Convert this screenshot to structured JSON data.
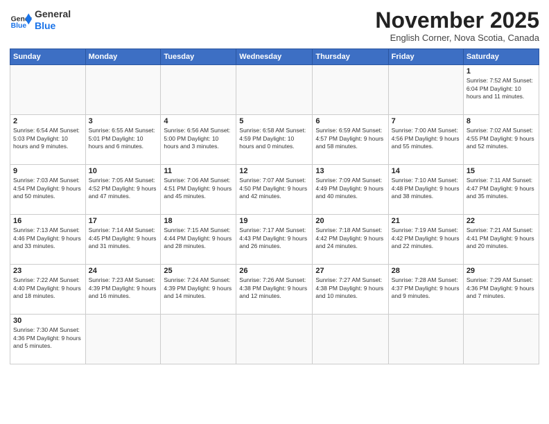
{
  "header": {
    "logo_general": "General",
    "logo_blue": "Blue",
    "month": "November 2025",
    "location": "English Corner, Nova Scotia, Canada"
  },
  "days_of_week": [
    "Sunday",
    "Monday",
    "Tuesday",
    "Wednesday",
    "Thursday",
    "Friday",
    "Saturday"
  ],
  "weeks": [
    [
      {
        "day": "",
        "info": ""
      },
      {
        "day": "",
        "info": ""
      },
      {
        "day": "",
        "info": ""
      },
      {
        "day": "",
        "info": ""
      },
      {
        "day": "",
        "info": ""
      },
      {
        "day": "",
        "info": ""
      },
      {
        "day": "1",
        "info": "Sunrise: 7:52 AM\nSunset: 6:04 PM\nDaylight: 10 hours\nand 11 minutes."
      }
    ],
    [
      {
        "day": "2",
        "info": "Sunrise: 6:54 AM\nSunset: 5:03 PM\nDaylight: 10 hours\nand 9 minutes."
      },
      {
        "day": "3",
        "info": "Sunrise: 6:55 AM\nSunset: 5:01 PM\nDaylight: 10 hours\nand 6 minutes."
      },
      {
        "day": "4",
        "info": "Sunrise: 6:56 AM\nSunset: 5:00 PM\nDaylight: 10 hours\nand 3 minutes."
      },
      {
        "day": "5",
        "info": "Sunrise: 6:58 AM\nSunset: 4:59 PM\nDaylight: 10 hours\nand 0 minutes."
      },
      {
        "day": "6",
        "info": "Sunrise: 6:59 AM\nSunset: 4:57 PM\nDaylight: 9 hours\nand 58 minutes."
      },
      {
        "day": "7",
        "info": "Sunrise: 7:00 AM\nSunset: 4:56 PM\nDaylight: 9 hours\nand 55 minutes."
      },
      {
        "day": "8",
        "info": "Sunrise: 7:02 AM\nSunset: 4:55 PM\nDaylight: 9 hours\nand 52 minutes."
      }
    ],
    [
      {
        "day": "9",
        "info": "Sunrise: 7:03 AM\nSunset: 4:54 PM\nDaylight: 9 hours\nand 50 minutes."
      },
      {
        "day": "10",
        "info": "Sunrise: 7:05 AM\nSunset: 4:52 PM\nDaylight: 9 hours\nand 47 minutes."
      },
      {
        "day": "11",
        "info": "Sunrise: 7:06 AM\nSunset: 4:51 PM\nDaylight: 9 hours\nand 45 minutes."
      },
      {
        "day": "12",
        "info": "Sunrise: 7:07 AM\nSunset: 4:50 PM\nDaylight: 9 hours\nand 42 minutes."
      },
      {
        "day": "13",
        "info": "Sunrise: 7:09 AM\nSunset: 4:49 PM\nDaylight: 9 hours\nand 40 minutes."
      },
      {
        "day": "14",
        "info": "Sunrise: 7:10 AM\nSunset: 4:48 PM\nDaylight: 9 hours\nand 38 minutes."
      },
      {
        "day": "15",
        "info": "Sunrise: 7:11 AM\nSunset: 4:47 PM\nDaylight: 9 hours\nand 35 minutes."
      }
    ],
    [
      {
        "day": "16",
        "info": "Sunrise: 7:13 AM\nSunset: 4:46 PM\nDaylight: 9 hours\nand 33 minutes."
      },
      {
        "day": "17",
        "info": "Sunrise: 7:14 AM\nSunset: 4:45 PM\nDaylight: 9 hours\nand 31 minutes."
      },
      {
        "day": "18",
        "info": "Sunrise: 7:15 AM\nSunset: 4:44 PM\nDaylight: 9 hours\nand 28 minutes."
      },
      {
        "day": "19",
        "info": "Sunrise: 7:17 AM\nSunset: 4:43 PM\nDaylight: 9 hours\nand 26 minutes."
      },
      {
        "day": "20",
        "info": "Sunrise: 7:18 AM\nSunset: 4:42 PM\nDaylight: 9 hours\nand 24 minutes."
      },
      {
        "day": "21",
        "info": "Sunrise: 7:19 AM\nSunset: 4:42 PM\nDaylight: 9 hours\nand 22 minutes."
      },
      {
        "day": "22",
        "info": "Sunrise: 7:21 AM\nSunset: 4:41 PM\nDaylight: 9 hours\nand 20 minutes."
      }
    ],
    [
      {
        "day": "23",
        "info": "Sunrise: 7:22 AM\nSunset: 4:40 PM\nDaylight: 9 hours\nand 18 minutes."
      },
      {
        "day": "24",
        "info": "Sunrise: 7:23 AM\nSunset: 4:39 PM\nDaylight: 9 hours\nand 16 minutes."
      },
      {
        "day": "25",
        "info": "Sunrise: 7:24 AM\nSunset: 4:39 PM\nDaylight: 9 hours\nand 14 minutes."
      },
      {
        "day": "26",
        "info": "Sunrise: 7:26 AM\nSunset: 4:38 PM\nDaylight: 9 hours\nand 12 minutes."
      },
      {
        "day": "27",
        "info": "Sunrise: 7:27 AM\nSunset: 4:38 PM\nDaylight: 9 hours\nand 10 minutes."
      },
      {
        "day": "28",
        "info": "Sunrise: 7:28 AM\nSunset: 4:37 PM\nDaylight: 9 hours\nand 9 minutes."
      },
      {
        "day": "29",
        "info": "Sunrise: 7:29 AM\nSunset: 4:36 PM\nDaylight: 9 hours\nand 7 minutes."
      }
    ],
    [
      {
        "day": "30",
        "info": "Sunrise: 7:30 AM\nSunset: 4:36 PM\nDaylight: 9 hours\nand 5 minutes."
      },
      {
        "day": "",
        "info": ""
      },
      {
        "day": "",
        "info": ""
      },
      {
        "day": "",
        "info": ""
      },
      {
        "day": "",
        "info": ""
      },
      {
        "day": "",
        "info": ""
      },
      {
        "day": "",
        "info": ""
      }
    ]
  ]
}
